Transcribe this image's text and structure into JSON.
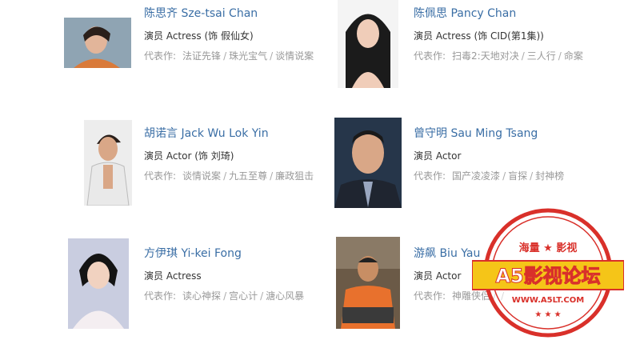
{
  "cast": [
    {
      "name": "陈思齐 Sze-tsai Chan",
      "role": "演员 Actress (饰 假仙女)",
      "works_label": "代表作:",
      "works": [
        "法证先锋",
        "珠光宝气",
        "谈情说案"
      ]
    },
    {
      "name": "陈佩思 Pancy Chan",
      "role": "演员 Actress (饰 CID(第1集))",
      "works_label": "代表作:",
      "works": [
        "扫毒2:天地对决",
        "三人行",
        "命案"
      ]
    },
    {
      "name": "胡诺言 Jack Wu Lok Yin",
      "role": "演员 Actor (饰 刘琦)",
      "works_label": "代表作:",
      "works": [
        "谈情说案",
        "九五至尊",
        "廉政狙击"
      ]
    },
    {
      "name": "曾守明 Sau Ming Tsang",
      "role": "演员 Actor",
      "works_label": "代表作:",
      "works": [
        "国产凌凌漆",
        "盲探",
        "封神榜"
      ]
    },
    {
      "name": "方伊琪 Yi-kei Fong",
      "role": "演员 Actress",
      "works_label": "代表作:",
      "works": [
        "读心神探",
        "宫心计",
        "溏心风暴"
      ]
    },
    {
      "name": "游飙 Biu Yau",
      "role": "演员 Actor",
      "works_label": "代表作:",
      "works": [
        "神雕侠侣",
        "",
        "",
        ""
      ]
    }
  ],
  "watermark": {
    "top_text": "海量 ★ 影视",
    "main_text": "A5影视论坛",
    "url_text": "WWW.A5LT.COM"
  },
  "colors": {
    "name": "#3a6ea5",
    "text": "#333333",
    "muted": "#999999",
    "stamp_red": "#d9302a",
    "stamp_yellow": "#f5c518"
  }
}
